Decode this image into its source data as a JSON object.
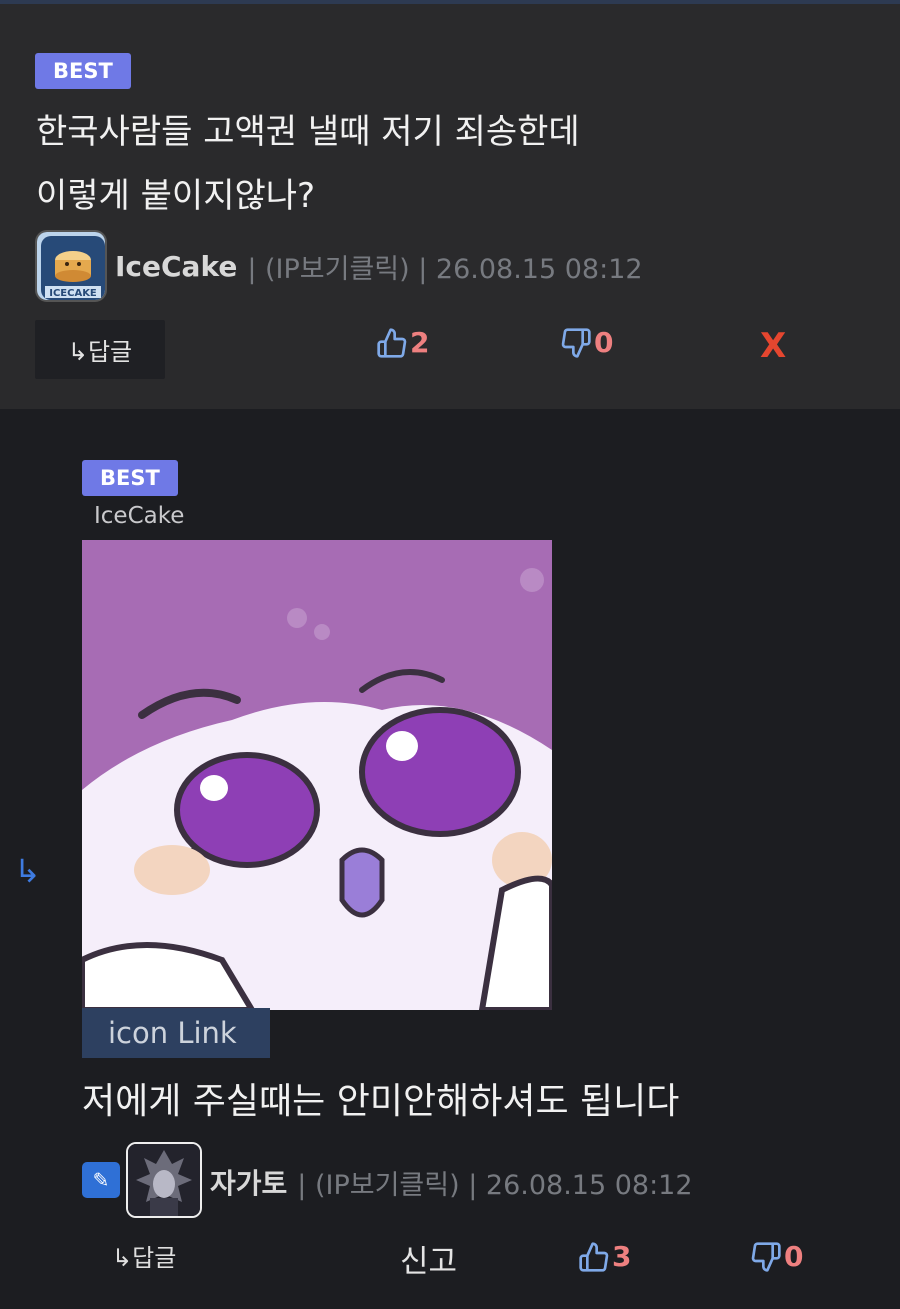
{
  "comment": {
    "badge": "BEST",
    "title_line1": "한국사람들 고액권 낼때 저기 죄송한데",
    "title_line2": "이렇게 붙이지않나?",
    "author": "IceCake",
    "meta": "| (IP보기클릭) | 26.08.15 08:12",
    "reply_label": "↳답글",
    "like_count": "2",
    "dislike_count": "0",
    "close_label": "X"
  },
  "reply": {
    "badge": "BEST",
    "reply_to": "IceCake",
    "image_alt": "purple cartoon character sticker",
    "icon_link_label": "icon Link",
    "body": "저에게 주실때는 안미안해하셔도 됩니다",
    "author": "자가토",
    "meta": "| (IP보기클릭) | 26.08.15 08:12",
    "reply_label": "↳답글",
    "report_label": "신고",
    "like_count": "3",
    "dislike_count": "0"
  },
  "colors": {
    "badge": "#6f79e6",
    "count": "#ee8080",
    "close": "#e5462f",
    "accent_blue": "#3e7be0"
  }
}
